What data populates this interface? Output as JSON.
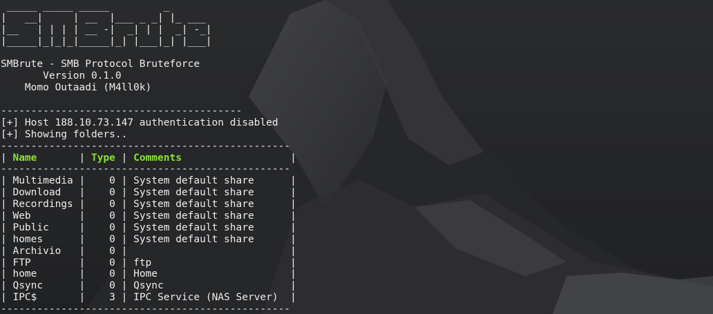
{
  "banner": [
    " _____ _____ _____         _       ",
    "|   __|     | __  |___ _ _| |_ ___ ",
    "|__   | | | | __ -|  _| | |  _| -_|",
    "|_____|_|_|_|_____|_| |___|_| |___|"
  ],
  "intro": [
    "",
    "SMBrute - SMB Protocol Bruteforce",
    "       Version 0.1.0",
    "    Momo Outaadi (M4ll0k)",
    ""
  ],
  "divider_short": "----------------------------------------",
  "messages": [
    "[+] Host 188.10.73.147 authentication disabled",
    "[+] Showing folders.."
  ],
  "divider_long": "------------------------------------------------",
  "table": {
    "headers": {
      "name": "Name",
      "type": "Type",
      "comments": "Comments"
    },
    "rows": [
      {
        "name": "Multimedia",
        "type": "0",
        "comment": "System default share"
      },
      {
        "name": "Download",
        "type": "0",
        "comment": "System default share"
      },
      {
        "name": "Recordings",
        "type": "0",
        "comment": "System default share"
      },
      {
        "name": "Web",
        "type": "0",
        "comment": "System default share"
      },
      {
        "name": "Public",
        "type": "0",
        "comment": "System default share"
      },
      {
        "name": "homes",
        "type": "0",
        "comment": "System default share"
      },
      {
        "name": "Archivio",
        "type": "0",
        "comment": ""
      },
      {
        "name": "FTP",
        "type": "0",
        "comment": "ftp"
      },
      {
        "name": "home",
        "type": "0",
        "comment": "Home"
      },
      {
        "name": "Qsync",
        "type": "0",
        "comment": "Qsync"
      },
      {
        "name": "IPC$",
        "type": "3",
        "comment": "IPC Service (NAS Server)"
      }
    ]
  },
  "colors": {
    "text": "#ededed",
    "header_accent": "#8ae234",
    "background": "#1c1d1f"
  }
}
